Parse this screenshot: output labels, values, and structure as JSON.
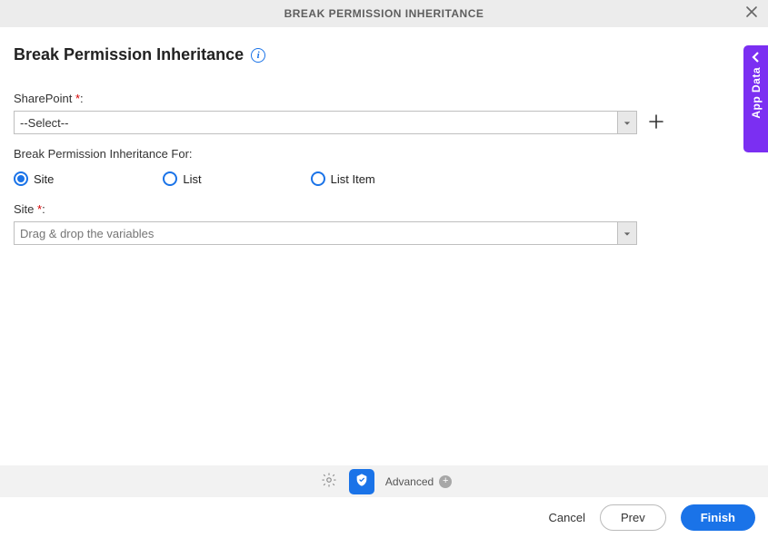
{
  "header": {
    "title": "BREAK PERMISSION INHERITANCE"
  },
  "page": {
    "title": "Break Permission Inheritance"
  },
  "fields": {
    "sharepoint": {
      "label": "SharePoint ",
      "req": "*",
      "colon": ":",
      "value": "--Select--"
    },
    "break_for": {
      "label": "Break Permission Inheritance For:",
      "options": [
        {
          "label": "Site",
          "selected": true
        },
        {
          "label": "List",
          "selected": false
        },
        {
          "label": "List Item",
          "selected": false
        }
      ]
    },
    "site": {
      "label": "Site ",
      "req": "*",
      "colon": ":",
      "placeholder": "Drag & drop the variables"
    }
  },
  "sidepanel": {
    "label": "App Data"
  },
  "toolbar": {
    "advanced_label": "Advanced"
  },
  "footer": {
    "cancel": "Cancel",
    "prev": "Prev",
    "finish": "Finish"
  }
}
